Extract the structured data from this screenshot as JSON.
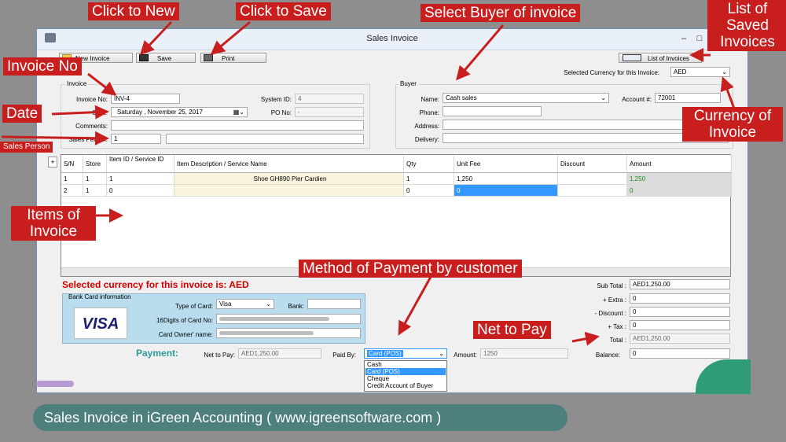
{
  "window": {
    "title": "Sales Invoice"
  },
  "toolbar": {
    "new_label": "New Invoice",
    "save_label": "Save",
    "print_label": "Print",
    "list_label": "List of Invoices"
  },
  "header": {
    "currency_label": "Selected Currency for this Invoice:",
    "currency_value": "AED",
    "invoice_group": "Invoice",
    "invoice_no_label": "Invoice No:",
    "invoice_no": "INV-4",
    "date_label": "Date:",
    "date_value": "Saturday  , November 25, 2017",
    "system_id_label": "System ID:",
    "system_id": "4",
    "po_label": "PO No:",
    "po_value": "-",
    "comments_label": "Comments:",
    "sales_person_label": "Sales Person:",
    "sales_person": "1"
  },
  "buyer": {
    "group": "Buyer",
    "name_label": "Name:",
    "name": "Cash sales",
    "account_label": "Account #:",
    "account": "72001",
    "phone_label": "Phone:",
    "address_label": "Address:",
    "delivery_label": "Delivery:"
  },
  "grid": {
    "add_label": "+",
    "columns": [
      "S/N",
      "Store",
      "Item ID / Service ID",
      "Item Description  / Service Name",
      "Qty",
      "Unit Fee",
      "Discount",
      "Amount"
    ],
    "rows": [
      {
        "sn": "1",
        "store": "1",
        "item_id": "1",
        "desc": "Shoe GH890 Pier Cardien",
        "qty": "1",
        "fee": "1,250",
        "discount": "",
        "amount": "1,250"
      },
      {
        "sn": "2",
        "store": "1",
        "item_id": "0",
        "desc": "",
        "qty": "0",
        "fee": "0",
        "discount": "",
        "amount": "0"
      }
    ]
  },
  "currency_note": "Selected currency for this invoice is: AED",
  "card": {
    "group": "Bank Card information",
    "logo": "VISA",
    "type_label": "Type of Card:",
    "type_value": "Visa",
    "bank_label": "Bank:",
    "digits_label": "16Digits of Card No:",
    "owner_label": "Card Owner' name:"
  },
  "totals": {
    "subtotal_label": "Sub Total :",
    "subtotal": "AED1,250.00",
    "extra_label": "+ Extra :",
    "extra": "0",
    "discount_label": "- Discount :",
    "discount": "0",
    "tax_label": "+ Tax :",
    "tax": "0",
    "total_label": "Total :",
    "total": "AED1,250.00",
    "balance_label": "Balance:",
    "balance": "0"
  },
  "payment": {
    "label": "Payment:",
    "net_label": "Net to Pay:",
    "net_value": "AED1,250.00",
    "paid_by_label": "Paid By:",
    "paid_by": "Card (POS)",
    "amount_label": "Amount:",
    "amount": "1250",
    "options": [
      "Cash",
      "Card (POS)",
      "Cheque",
      "Credit Account of Buyer"
    ]
  },
  "annotations": {
    "new": "Click to New",
    "save": "Click to Save",
    "buyer": "Select Buyer of invoice",
    "list": "List of Saved Invoices",
    "invoice_no": "Invoice No",
    "date": "Date",
    "sales_person": "Sales Person",
    "currency": "Currency of Invoice",
    "items": "Items of Invoice",
    "method": "Method of Payment by customer",
    "net": "Net to Pay"
  },
  "footer": "Sales Invoice in iGreen Accounting  (  www.igreensoftware.com  )",
  "colors": {
    "annotation": "#c81e1e",
    "banner": "#4d7f7c",
    "selection": "#3399ff",
    "note_red": "#d40000",
    "amount_green": "#1d8a1d"
  }
}
